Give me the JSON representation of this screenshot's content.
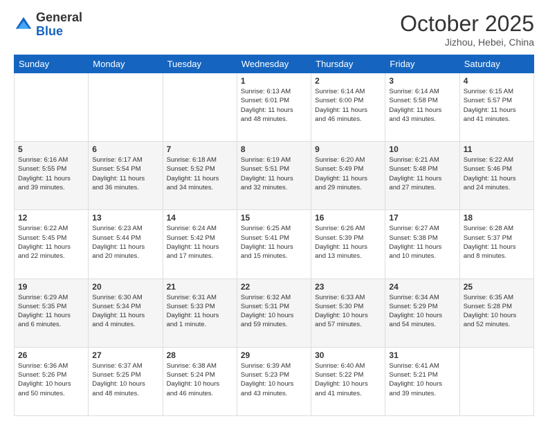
{
  "logo": {
    "general": "General",
    "blue": "Blue"
  },
  "header": {
    "month": "October 2025",
    "location": "Jizhou, Hebei, China"
  },
  "weekdays": [
    "Sunday",
    "Monday",
    "Tuesday",
    "Wednesday",
    "Thursday",
    "Friday",
    "Saturday"
  ],
  "weeks": [
    [
      {
        "day": "",
        "info": ""
      },
      {
        "day": "",
        "info": ""
      },
      {
        "day": "",
        "info": ""
      },
      {
        "day": "1",
        "info": "Sunrise: 6:13 AM\nSunset: 6:01 PM\nDaylight: 11 hours\nand 48 minutes."
      },
      {
        "day": "2",
        "info": "Sunrise: 6:14 AM\nSunset: 6:00 PM\nDaylight: 11 hours\nand 46 minutes."
      },
      {
        "day": "3",
        "info": "Sunrise: 6:14 AM\nSunset: 5:58 PM\nDaylight: 11 hours\nand 43 minutes."
      },
      {
        "day": "4",
        "info": "Sunrise: 6:15 AM\nSunset: 5:57 PM\nDaylight: 11 hours\nand 41 minutes."
      }
    ],
    [
      {
        "day": "5",
        "info": "Sunrise: 6:16 AM\nSunset: 5:55 PM\nDaylight: 11 hours\nand 39 minutes."
      },
      {
        "day": "6",
        "info": "Sunrise: 6:17 AM\nSunset: 5:54 PM\nDaylight: 11 hours\nand 36 minutes."
      },
      {
        "day": "7",
        "info": "Sunrise: 6:18 AM\nSunset: 5:52 PM\nDaylight: 11 hours\nand 34 minutes."
      },
      {
        "day": "8",
        "info": "Sunrise: 6:19 AM\nSunset: 5:51 PM\nDaylight: 11 hours\nand 32 minutes."
      },
      {
        "day": "9",
        "info": "Sunrise: 6:20 AM\nSunset: 5:49 PM\nDaylight: 11 hours\nand 29 minutes."
      },
      {
        "day": "10",
        "info": "Sunrise: 6:21 AM\nSunset: 5:48 PM\nDaylight: 11 hours\nand 27 minutes."
      },
      {
        "day": "11",
        "info": "Sunrise: 6:22 AM\nSunset: 5:46 PM\nDaylight: 11 hours\nand 24 minutes."
      }
    ],
    [
      {
        "day": "12",
        "info": "Sunrise: 6:22 AM\nSunset: 5:45 PM\nDaylight: 11 hours\nand 22 minutes."
      },
      {
        "day": "13",
        "info": "Sunrise: 6:23 AM\nSunset: 5:44 PM\nDaylight: 11 hours\nand 20 minutes."
      },
      {
        "day": "14",
        "info": "Sunrise: 6:24 AM\nSunset: 5:42 PM\nDaylight: 11 hours\nand 17 minutes."
      },
      {
        "day": "15",
        "info": "Sunrise: 6:25 AM\nSunset: 5:41 PM\nDaylight: 11 hours\nand 15 minutes."
      },
      {
        "day": "16",
        "info": "Sunrise: 6:26 AM\nSunset: 5:39 PM\nDaylight: 11 hours\nand 13 minutes."
      },
      {
        "day": "17",
        "info": "Sunrise: 6:27 AM\nSunset: 5:38 PM\nDaylight: 11 hours\nand 10 minutes."
      },
      {
        "day": "18",
        "info": "Sunrise: 6:28 AM\nSunset: 5:37 PM\nDaylight: 11 hours\nand 8 minutes."
      }
    ],
    [
      {
        "day": "19",
        "info": "Sunrise: 6:29 AM\nSunset: 5:35 PM\nDaylight: 11 hours\nand 6 minutes."
      },
      {
        "day": "20",
        "info": "Sunrise: 6:30 AM\nSunset: 5:34 PM\nDaylight: 11 hours\nand 4 minutes."
      },
      {
        "day": "21",
        "info": "Sunrise: 6:31 AM\nSunset: 5:33 PM\nDaylight: 11 hours\nand 1 minute."
      },
      {
        "day": "22",
        "info": "Sunrise: 6:32 AM\nSunset: 5:31 PM\nDaylight: 10 hours\nand 59 minutes."
      },
      {
        "day": "23",
        "info": "Sunrise: 6:33 AM\nSunset: 5:30 PM\nDaylight: 10 hours\nand 57 minutes."
      },
      {
        "day": "24",
        "info": "Sunrise: 6:34 AM\nSunset: 5:29 PM\nDaylight: 10 hours\nand 54 minutes."
      },
      {
        "day": "25",
        "info": "Sunrise: 6:35 AM\nSunset: 5:28 PM\nDaylight: 10 hours\nand 52 minutes."
      }
    ],
    [
      {
        "day": "26",
        "info": "Sunrise: 6:36 AM\nSunset: 5:26 PM\nDaylight: 10 hours\nand 50 minutes."
      },
      {
        "day": "27",
        "info": "Sunrise: 6:37 AM\nSunset: 5:25 PM\nDaylight: 10 hours\nand 48 minutes."
      },
      {
        "day": "28",
        "info": "Sunrise: 6:38 AM\nSunset: 5:24 PM\nDaylight: 10 hours\nand 46 minutes."
      },
      {
        "day": "29",
        "info": "Sunrise: 6:39 AM\nSunset: 5:23 PM\nDaylight: 10 hours\nand 43 minutes."
      },
      {
        "day": "30",
        "info": "Sunrise: 6:40 AM\nSunset: 5:22 PM\nDaylight: 10 hours\nand 41 minutes."
      },
      {
        "day": "31",
        "info": "Sunrise: 6:41 AM\nSunset: 5:21 PM\nDaylight: 10 hours\nand 39 minutes."
      },
      {
        "day": "",
        "info": ""
      }
    ]
  ]
}
